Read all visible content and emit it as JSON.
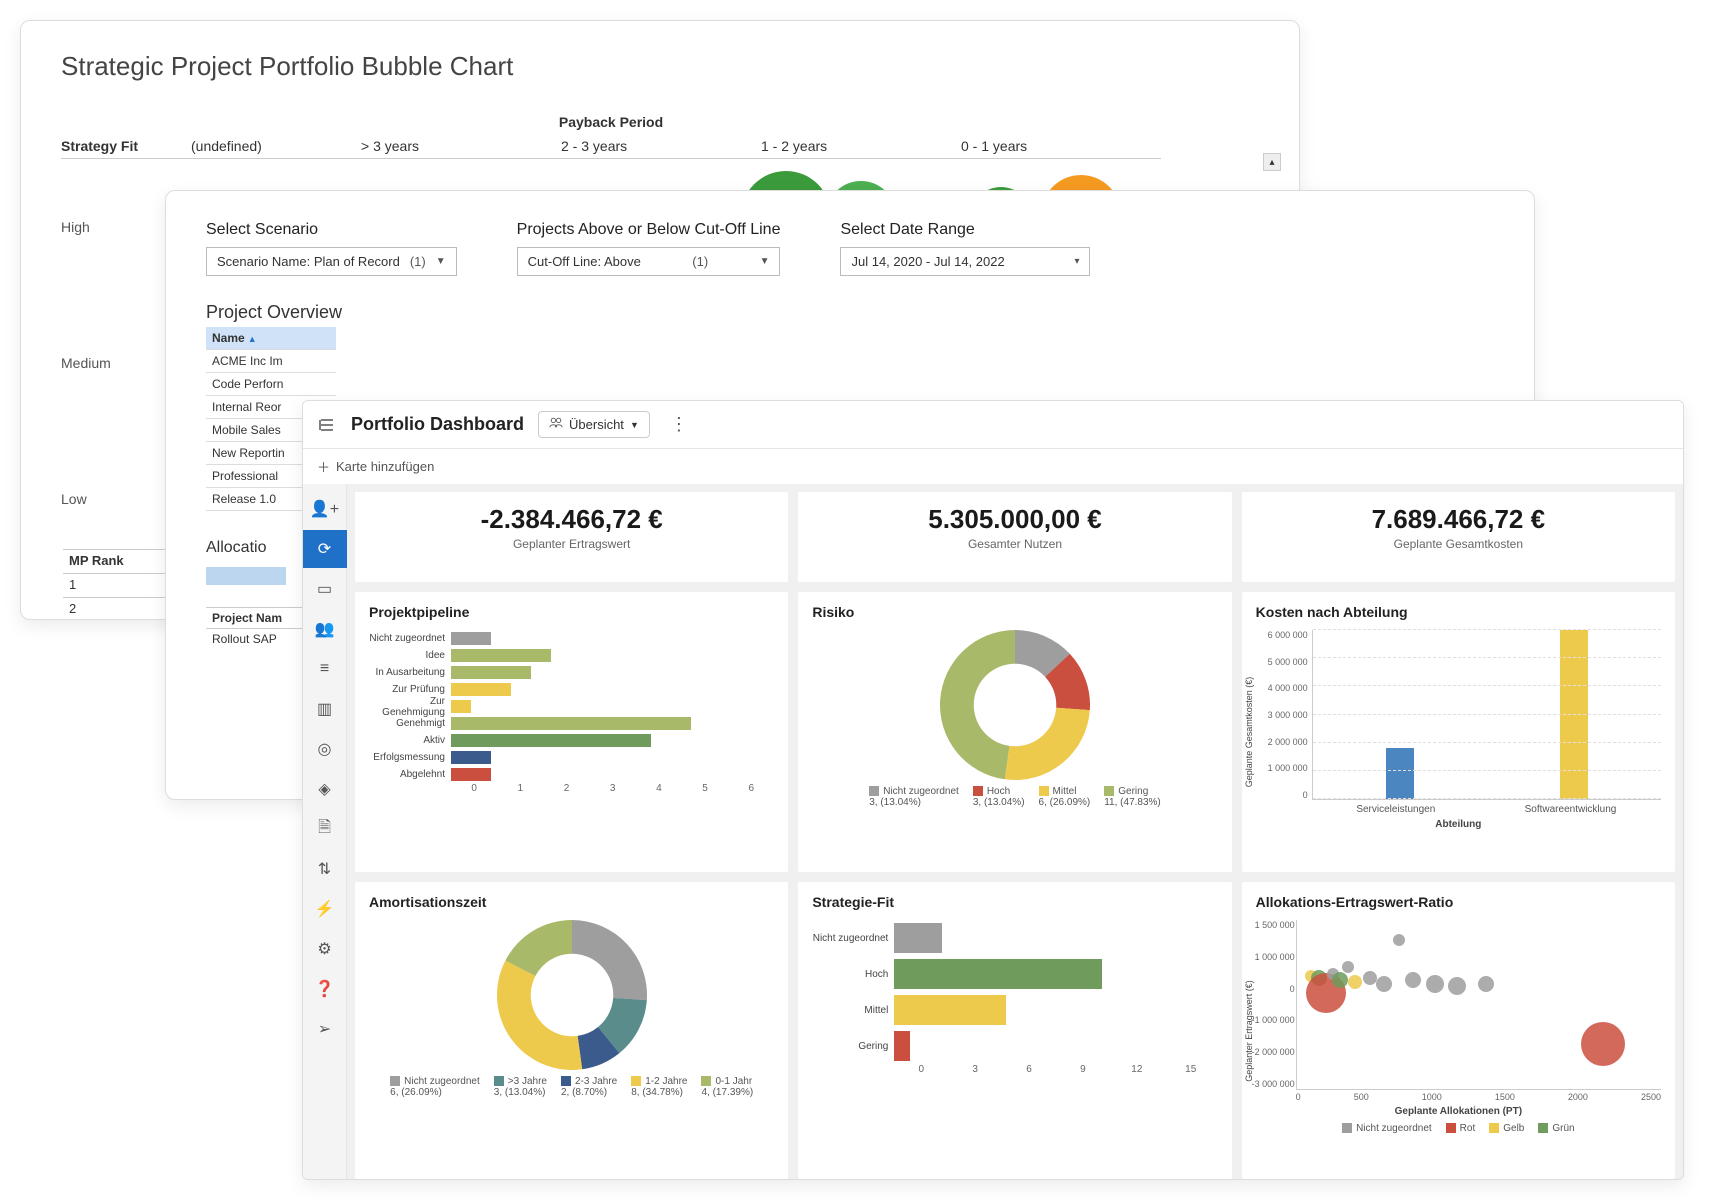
{
  "window1": {
    "title": "Strategic Project Portfolio Bubble Chart",
    "x_axis_title": "Payback Period",
    "row_label": "Strategy Fit",
    "x_categories": [
      "(undefined)",
      "> 3 years",
      "2 - 3 years",
      "1 - 2 years",
      "0 - 1 years"
    ],
    "y_categories": [
      "High",
      "Medium",
      "Low"
    ],
    "mp_table": {
      "header": "MP Rank",
      "rows": [
        "1",
        "2"
      ]
    }
  },
  "window2": {
    "filters": {
      "scenario": {
        "label": "Select Scenario",
        "field": "Scenario Name",
        "value": "Plan of Record",
        "count": "(1)"
      },
      "cutoff": {
        "label": "Projects Above or Below Cut-Off Line",
        "field": "Cut-Off Line",
        "value": "Above",
        "count": "(1)"
      },
      "date": {
        "label": "Select Date Range",
        "value": "Jul 14, 2020 - Jul 14, 2022"
      }
    },
    "overview_title": "Project Overview",
    "table": {
      "header": "Name",
      "rows": [
        "ACME Inc Im",
        "Code Perforn",
        "Internal Reor",
        "Mobile Sales",
        "New Reportin",
        "Professional",
        "Release 1.0"
      ]
    },
    "alloc_title": "Allocatio",
    "mini_table": {
      "header": "Project Nam",
      "row": "Rollout SAP"
    }
  },
  "window3": {
    "toolbar": {
      "title": "Portfolio Dashboard",
      "view_label": "Übersicht",
      "add_card": "Karte hinzufügen"
    },
    "sidebar_icons": [
      "person-add-icon",
      "refresh-icon",
      "badge-icon",
      "group-icon",
      "list-icon",
      "columns-icon",
      "target-icon",
      "diamond-icon",
      "file-icon",
      "sort-icon",
      "plug-icon",
      "gear-icon",
      "help-icon",
      "compass-icon"
    ],
    "metrics": [
      {
        "value": "-2.384.466,72 €",
        "label": "Geplanter Ertragswert"
      },
      {
        "value": "5.305.000,00 €",
        "label": "Gesamter Nutzen"
      },
      {
        "value": "7.689.466,72 €",
        "label": "Geplante Gesamtkosten"
      }
    ],
    "cards": {
      "pipeline": {
        "title": "Projektpipeline"
      },
      "risk": {
        "title": "Risiko"
      },
      "dept": {
        "title": "Kosten nach Abteilung",
        "ylabel": "Geplante Gesamtkosten (€)",
        "xlabel": "Abteilung"
      },
      "amort": {
        "title": "Amortisationszeit"
      },
      "strat": {
        "title": "Strategie-Fit"
      },
      "ratio": {
        "title": "Allokations-Ertragswert-Ratio",
        "ylabel": "Geplanter Ertragswert (€)",
        "xlabel": "Geplante Allokationen (PT)"
      }
    }
  },
  "colors": {
    "blue": "#4c86c0",
    "olive": "#a9b96a",
    "green": "#6f9b5c",
    "yellow": "#edc94c",
    "red": "#cb4f3e",
    "grey": "#9e9e9e",
    "navy": "#3b5b8c",
    "teal": "#5b8c8c"
  },
  "chart_data": [
    {
      "id": "pipeline",
      "type": "bar",
      "orientation": "horizontal",
      "categories": [
        "Nicht zugeordnet",
        "Idee",
        "In Ausarbeitung",
        "Zur Prüfung",
        "Zur Genehmigung",
        "Genehmigt",
        "Aktiv",
        "Erfolgsmessung",
        "Abgelehnt"
      ],
      "values": [
        1,
        2.5,
        2,
        1.5,
        0.5,
        6,
        5,
        1,
        1
      ],
      "colors_by_cat": [
        "grey",
        "olive",
        "olive",
        "yellow",
        "yellow",
        "olive",
        "green",
        "navy",
        "red"
      ],
      "xlim": [
        0,
        6
      ],
      "xticks": [
        0,
        1,
        2,
        3,
        4,
        5,
        6
      ]
    },
    {
      "id": "risk",
      "type": "pie",
      "donut": true,
      "series": [
        {
          "name": "Nicht zugeordnet",
          "label": "3, (13.04%)",
          "value": 13.04,
          "color": "grey"
        },
        {
          "name": "Hoch",
          "label": "3, (13.04%)",
          "value": 13.04,
          "color": "red"
        },
        {
          "name": "Mittel",
          "label": "6, (26.09%)",
          "value": 26.09,
          "color": "yellow"
        },
        {
          "name": "Gering",
          "label": "11, (47.83%)",
          "value": 47.83,
          "color": "olive"
        }
      ]
    },
    {
      "id": "dept",
      "type": "bar",
      "categories": [
        "Serviceleistungen",
        "Softwareentwicklung"
      ],
      "values": [
        1800000,
        6000000
      ],
      "colors_by_cat": [
        "blue",
        "yellow"
      ],
      "ylim": [
        0,
        6000000
      ],
      "yticks": [
        0,
        1000000,
        2000000,
        3000000,
        4000000,
        5000000,
        6000000
      ],
      "ytick_labels": [
        "0",
        "1 000 000",
        "2 000 000",
        "3 000 000",
        "4 000 000",
        "5 000 000",
        "6 000 000"
      ]
    },
    {
      "id": "amort",
      "type": "pie",
      "donut": true,
      "series": [
        {
          "name": "Nicht zugeordnet",
          "label": "6, (26.09%)",
          "value": 26.09,
          "color": "grey"
        },
        {
          "name": ">3 Jahre",
          "label": "3, (13.04%)",
          "value": 13.04,
          "color": "teal"
        },
        {
          "name": "2-3 Jahre",
          "label": "2, (8.70%)",
          "value": 8.7,
          "color": "navy"
        },
        {
          "name": "1-2 Jahre",
          "label": "8, (34.78%)",
          "value": 34.78,
          "color": "yellow"
        },
        {
          "name": "0-1 Jahr",
          "label": "4, (17.39%)",
          "value": 17.39,
          "color": "olive"
        }
      ]
    },
    {
      "id": "strat",
      "type": "bar",
      "orientation": "horizontal",
      "categories": [
        "Nicht zugeordnet",
        "Hoch",
        "Mittel",
        "Gering"
      ],
      "values": [
        3,
        13,
        7,
        1
      ],
      "colors_by_cat": [
        "grey",
        "green",
        "yellow",
        "red"
      ],
      "xlim": [
        0,
        15
      ],
      "xticks": [
        0,
        3,
        6,
        9,
        12,
        15
      ]
    },
    {
      "id": "ratio",
      "type": "scatter",
      "xlim": [
        0,
        2500
      ],
      "ylim": [
        -3000000,
        1500000
      ],
      "xticks": [
        0,
        500,
        1000,
        1500,
        2000,
        2500
      ],
      "yticks": [
        -3000000,
        -2000000,
        -1000000,
        0,
        1000000,
        1500000
      ],
      "ytick_labels": [
        "-3 000 000",
        "-2 000 000",
        "-1 000 000",
        "0",
        "1 000 000",
        "1 500 000"
      ],
      "legend": [
        {
          "name": "Nicht zugeordnet",
          "color": "grey"
        },
        {
          "name": "Rot",
          "color": "red"
        },
        {
          "name": "Gelb",
          "color": "yellow"
        },
        {
          "name": "Grün",
          "color": "green"
        }
      ],
      "points": [
        {
          "x": 100,
          "y": 0,
          "r": 6,
          "color": "yellow"
        },
        {
          "x": 150,
          "y": -50000,
          "r": 8,
          "color": "green"
        },
        {
          "x": 200,
          "y": -450000,
          "r": 20,
          "color": "red"
        },
        {
          "x": 250,
          "y": 50000,
          "r": 6,
          "color": "grey"
        },
        {
          "x": 300,
          "y": -100000,
          "r": 8,
          "color": "green"
        },
        {
          "x": 350,
          "y": 250000,
          "r": 6,
          "color": "grey"
        },
        {
          "x": 400,
          "y": -150000,
          "r": 7,
          "color": "yellow"
        },
        {
          "x": 500,
          "y": -50000,
          "r": 7,
          "color": "grey"
        },
        {
          "x": 600,
          "y": -200000,
          "r": 8,
          "color": "grey"
        },
        {
          "x": 700,
          "y": 980000,
          "r": 6,
          "color": "grey"
        },
        {
          "x": 800,
          "y": -100000,
          "r": 8,
          "color": "grey"
        },
        {
          "x": 950,
          "y": -200000,
          "r": 9,
          "color": "grey"
        },
        {
          "x": 1100,
          "y": -250000,
          "r": 9,
          "color": "grey"
        },
        {
          "x": 1300,
          "y": -200000,
          "r": 8,
          "color": "grey"
        },
        {
          "x": 2100,
          "y": -1800000,
          "r": 22,
          "color": "red"
        }
      ]
    }
  ]
}
